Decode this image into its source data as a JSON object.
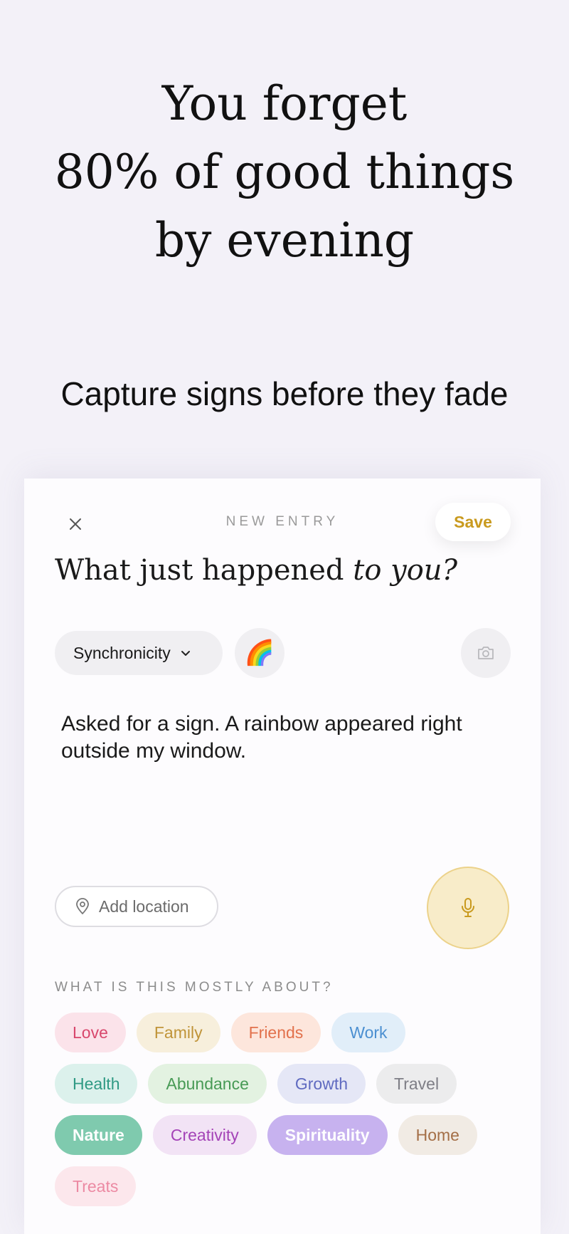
{
  "headline": [
    "You forget",
    "80% of good things",
    "by evening"
  ],
  "subtitle": "Capture signs before they fade",
  "entry": {
    "eyebrow": "NEW ENTRY",
    "save_label": "Save",
    "question_prefix": "What just happened ",
    "question_emphasis": "to you?",
    "type_value": "Synchronicity",
    "emoji": "🌈",
    "text": "Asked for a sign. A rainbow appeared right outside my window.",
    "location_label": "Add location",
    "section_label": "WHAT IS THIS MOSTLY ABOUT?"
  },
  "tags": [
    {
      "label": "Love",
      "bg": "#fbe3ea",
      "fg": "#d8476c",
      "selected": false
    },
    {
      "label": "Family",
      "bg": "#f7efdc",
      "fg": "#c09439",
      "selected": false
    },
    {
      "label": "Friends",
      "bg": "#fde6dc",
      "fg": "#e2714c",
      "selected": false
    },
    {
      "label": "Work",
      "bg": "#e1eef9",
      "fg": "#4b8fd1",
      "selected": false
    },
    {
      "label": "Health",
      "bg": "#dcf1ec",
      "fg": "#2f9a84",
      "selected": false
    },
    {
      "label": "Abundance",
      "bg": "#e3f2e1",
      "fg": "#479a55",
      "selected": false
    },
    {
      "label": "Growth",
      "bg": "#e5e7f6",
      "fg": "#5f6ac0",
      "selected": false
    },
    {
      "label": "Travel",
      "bg": "#ececed",
      "fg": "#7e7e86",
      "selected": false
    },
    {
      "label": "Nature",
      "bg": "#7fcaae",
      "fg": "#ffffff",
      "selected": true
    },
    {
      "label": "Creativity",
      "bg": "#f2e3f5",
      "fg": "#a443b7",
      "selected": false
    },
    {
      "label": "Spirituality",
      "bg": "#c7b2ef",
      "fg": "#ffffff",
      "selected": true
    },
    {
      "label": "Home",
      "bg": "#f1ebe4",
      "fg": "#a46f47",
      "selected": false
    },
    {
      "label": "Treats",
      "bg": "#fce7ec",
      "fg": "#ec8aa3",
      "selected": false
    }
  ],
  "colors": {
    "accent": "#c99a1e",
    "background": "#f3f1f8"
  },
  "icons": [
    "close-icon",
    "chevron-down-icon",
    "camera-icon",
    "location-pin-icon",
    "microphone-icon"
  ]
}
